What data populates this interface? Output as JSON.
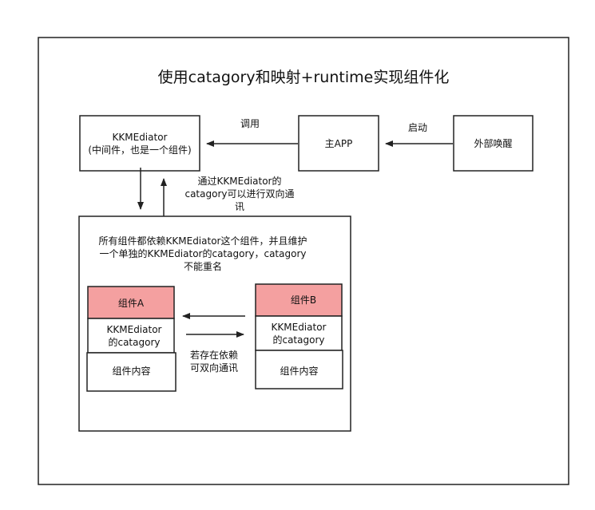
{
  "title": "使用catagory和映射+runtime实现组件化",
  "mediator": {
    "name": "KKMEdiator",
    "desc": "(中间件，也是一个组件)"
  },
  "main_app": "主APP",
  "external": "外部唤醒",
  "edge_call": "调用",
  "edge_launch": "启动",
  "via_mediator": "通过KKMEdiator的\ncatagory可以进行双向通\n讯",
  "note": "所有组件都依赖KKMEdiator这个组件，并且维护\n一个单独的KKMEdiator的catagory，catagory\n不能重名",
  "component_a": {
    "name": "组件A",
    "category": "KKMEdiator\n的catagory",
    "content": "组件内容"
  },
  "component_b": {
    "name": "组件B",
    "category": "KKMEdiator\n的catagory",
    "content": "组件内容"
  },
  "mutual": "若存在依赖\n可双向通讯",
  "colors": {
    "component_header": "#f4a0a0",
    "stroke": "#222222"
  }
}
